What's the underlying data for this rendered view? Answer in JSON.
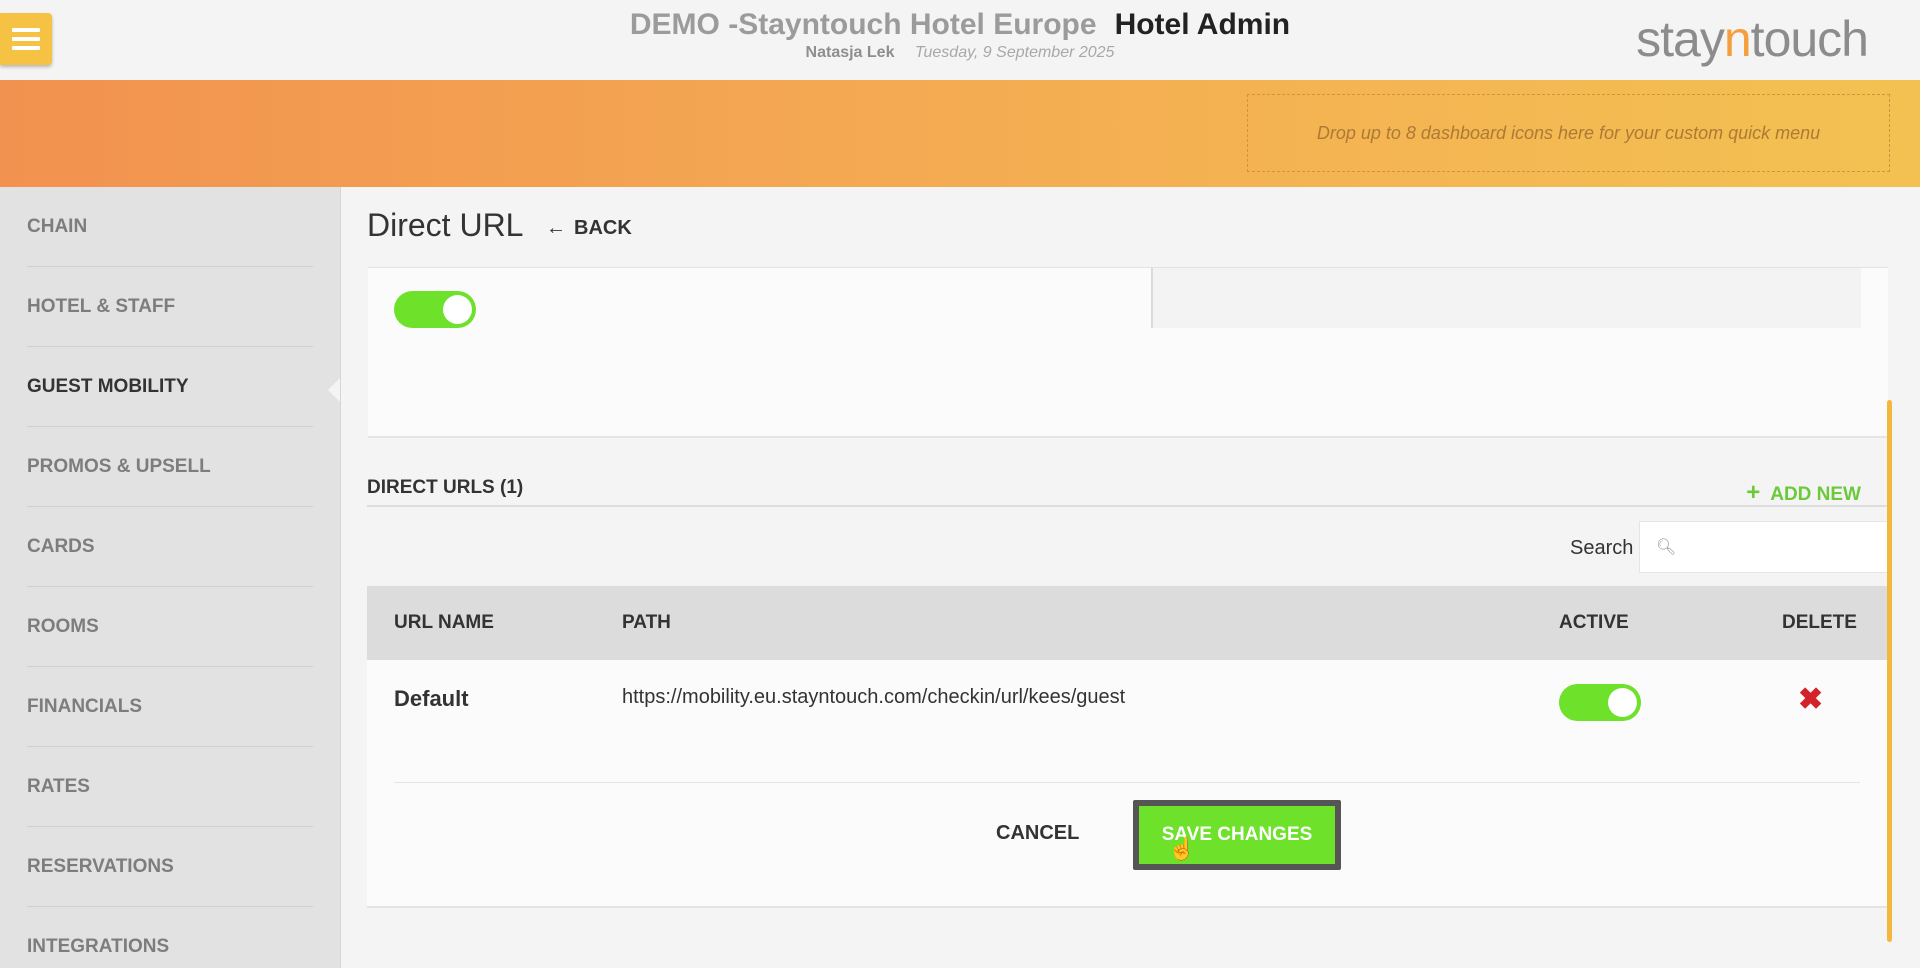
{
  "header": {
    "hotel_name": "DEMO -Stayntouch Hotel Europe",
    "app_name": "Hotel Admin",
    "user": "Natasja Lek",
    "date": "Tuesday, 9 September 2025",
    "logo_pre": "stay",
    "logo_accent": "n",
    "logo_post": "touch"
  },
  "quick_menu": {
    "placeholder": "Drop up to 8 dashboard icons here for your custom quick menu"
  },
  "sidebar": {
    "items": [
      {
        "label": "CHAIN"
      },
      {
        "label": "HOTEL & STAFF"
      },
      {
        "label": "GUEST MOBILITY"
      },
      {
        "label": "PROMOS & UPSELL"
      },
      {
        "label": "CARDS"
      },
      {
        "label": "ROOMS"
      },
      {
        "label": "FINANCIALS"
      },
      {
        "label": "RATES"
      },
      {
        "label": "RESERVATIONS"
      },
      {
        "label": "INTEGRATIONS"
      }
    ],
    "active_index": 2
  },
  "page": {
    "title": "Direct URL",
    "back_label": "BACK",
    "top_toggle_on": true
  },
  "direct_urls": {
    "section_title": "DIRECT URLS (1)",
    "add_new_label": "ADD NEW",
    "search_label": "Search",
    "search_value": "",
    "columns": [
      "URL NAME",
      "PATH",
      "ACTIVE",
      "DELETE"
    ],
    "rows": [
      {
        "name": "Default",
        "path": "https://mobility.eu.stayntouch.com/checkin/url/kees/guest",
        "active": true
      }
    ]
  },
  "actions": {
    "cancel_label": "CANCEL",
    "save_label": "SAVE CHANGES"
  },
  "colors": {
    "accent_orange": "#f29250",
    "toggle_green": "#6ee12b",
    "delete_red": "#d2232a",
    "add_green": "#6bc93a"
  }
}
